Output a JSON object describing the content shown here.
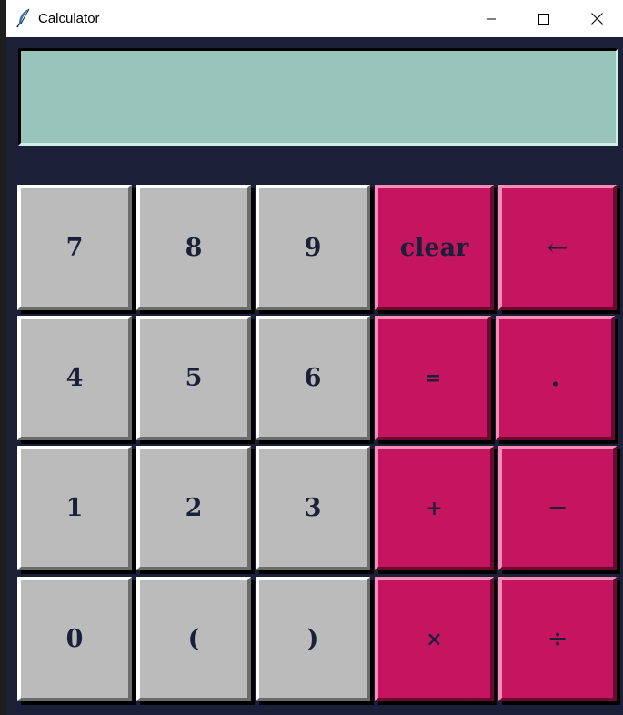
{
  "window": {
    "title": "Calculator"
  },
  "display": {
    "value": ""
  },
  "keys": {
    "row1": [
      "7",
      "8",
      "9",
      "clear",
      "←"
    ],
    "row2": [
      "4",
      "5",
      "6",
      "=",
      "."
    ],
    "row3": [
      "1",
      "2",
      "3",
      "+",
      "−"
    ],
    "row4": [
      "0",
      "(",
      ")",
      "×",
      "÷"
    ]
  },
  "colors": {
    "background": "#1b1f38",
    "display": "#98c4bc",
    "number_key": "#bbbbbb",
    "operator_key": "#c61560",
    "key_text": "#1b1f38"
  }
}
